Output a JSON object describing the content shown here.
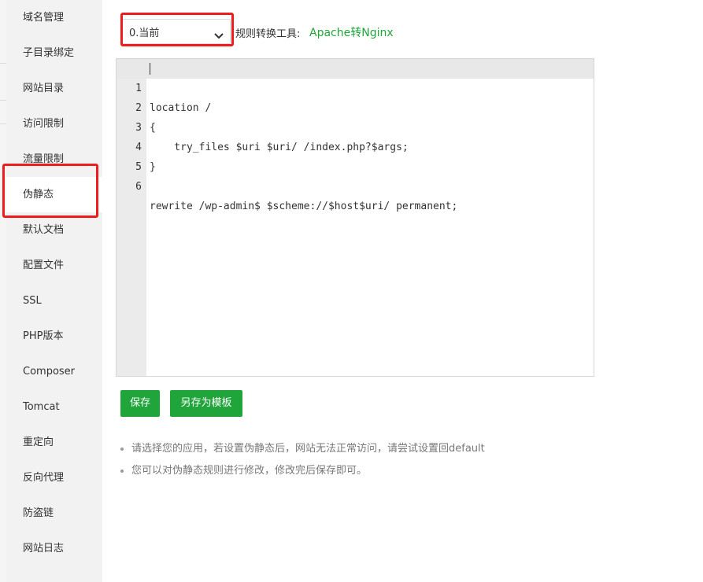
{
  "sidebar": {
    "items": [
      {
        "label": "域名管理"
      },
      {
        "label": "子目录绑定"
      },
      {
        "label": "网站目录"
      },
      {
        "label": "访问限制"
      },
      {
        "label": "流量限制"
      },
      {
        "label": "伪静态"
      },
      {
        "label": "默认文档"
      },
      {
        "label": "配置文件"
      },
      {
        "label": "SSL"
      },
      {
        "label": "PHP版本"
      },
      {
        "label": "Composer"
      },
      {
        "label": "Tomcat"
      },
      {
        "label": "重定向"
      },
      {
        "label": "反向代理"
      },
      {
        "label": "防盗链"
      },
      {
        "label": "网站日志"
      }
    ],
    "active": "伪静态"
  },
  "toolbar": {
    "template_select_value": "0.当前",
    "converter_label": "规则转换工具:",
    "converter_link": "Apache转Nginx"
  },
  "editor": {
    "line_numbers": [
      "1",
      "2",
      "3",
      "4",
      "5",
      "6"
    ],
    "lines": [
      "location /",
      "{",
      "    try_files $uri $uri/ /index.php?$args;",
      "}",
      "",
      "rewrite /wp-admin$ $scheme://$host$uri/ permanent;"
    ]
  },
  "actions": {
    "save_label": "保存",
    "save_as_template_label": "另存为模板"
  },
  "tips": [
    "请选择您的应用，若设置伪静态后，网站无法正常访问，请尝试设置回default",
    "您可以对伪静态规则进行修改，修改完后保存即可。"
  ],
  "colors": {
    "accent": "#20a53a",
    "highlight_box": "#ee1c1c",
    "sidebar_bg": "#f2f2f2"
  }
}
